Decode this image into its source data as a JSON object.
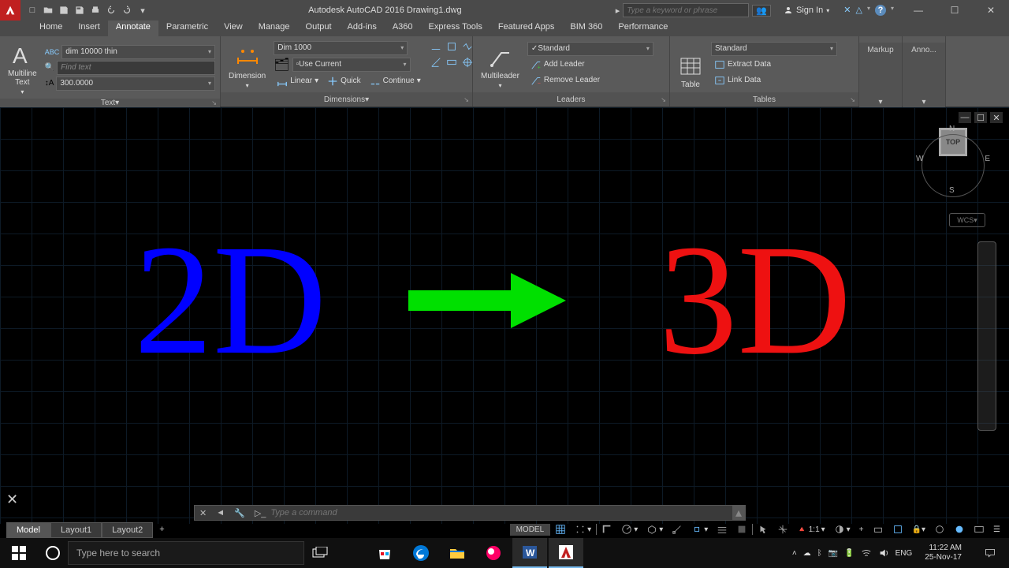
{
  "titlebar": {
    "title": "Autodesk AutoCAD 2016   Drawing1.dwg",
    "search_placeholder": "Type a keyword or phrase",
    "signin": "Sign In"
  },
  "menubar": {
    "tabs": [
      "Home",
      "Insert",
      "Annotate",
      "Parametric",
      "View",
      "Manage",
      "Output",
      "Add-ins",
      "A360",
      "Express Tools",
      "Featured Apps",
      "BIM 360",
      "Performance"
    ],
    "active": 2
  },
  "ribbon": {
    "text": {
      "big": "Multiline\nText",
      "style": "dim 10000 thin",
      "find_placeholder": "Find text",
      "height": "300.0000",
      "footer": "Text"
    },
    "dimensions": {
      "big": "Dimension",
      "dimstyle": "Dim 1000",
      "use_current": "Use Current",
      "linear": "Linear",
      "quick": "Quick",
      "continue": "Continue",
      "footer": "Dimensions"
    },
    "leaders": {
      "big": "Multileader",
      "style": "Standard",
      "add": "Add Leader",
      "remove": "Remove Leader",
      "footer": "Leaders"
    },
    "tables": {
      "big": "Table",
      "style": "Standard",
      "extract": "Extract Data",
      "link": "Link Data",
      "footer": "Tables"
    },
    "markup": {
      "footer": "Markup"
    },
    "anno": {
      "footer": "Anno..."
    }
  },
  "canvas": {
    "viewcube_top": "TOP",
    "dir_n": "N",
    "dir_s": "S",
    "dir_e": "E",
    "dir_w": "W",
    "wcs": "WCS",
    "text_left": "2D",
    "text_right": "3D"
  },
  "cmdline": {
    "placeholder": "Type a command"
  },
  "modeltabs": {
    "tabs": [
      "Model",
      "Layout1",
      "Layout2"
    ],
    "active": 0
  },
  "statusbar": {
    "model": "MODEL",
    "scale": "1:1"
  },
  "taskbar": {
    "search_placeholder": "Type here to search",
    "lang": "ENG",
    "time": "11:22 AM",
    "date": "25-Nov-17"
  }
}
